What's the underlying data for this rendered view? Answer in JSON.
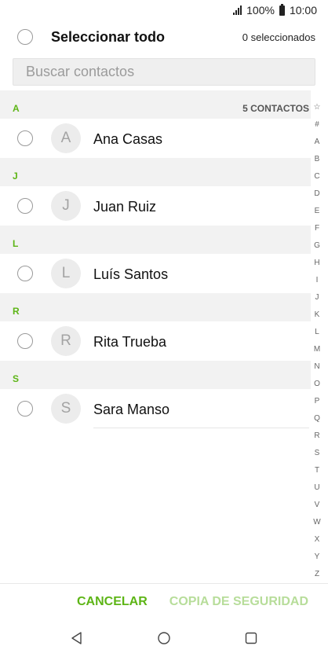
{
  "status_bar": {
    "battery_pct": "100%",
    "time": "10:00"
  },
  "header": {
    "select_all": "Seleccionar todo",
    "selected_count": "0 seleccionados"
  },
  "search": {
    "placeholder": "Buscar contactos"
  },
  "contacts_total": "5 CONTACTOS",
  "sections": [
    {
      "letter": "A",
      "contacts": [
        {
          "initial": "A",
          "name": "Ana Casas"
        }
      ]
    },
    {
      "letter": "J",
      "contacts": [
        {
          "initial": "J",
          "name": "Juan Ruiz"
        }
      ]
    },
    {
      "letter": "L",
      "contacts": [
        {
          "initial": "L",
          "name": "Luís Santos"
        }
      ]
    },
    {
      "letter": "R",
      "contacts": [
        {
          "initial": "R",
          "name": "Rita Trueba"
        }
      ]
    },
    {
      "letter": "S",
      "contacts": [
        {
          "initial": "S",
          "name": "Sara Manso"
        }
      ]
    }
  ],
  "index_letters": [
    "☆",
    "#",
    "A",
    "B",
    "C",
    "D",
    "E",
    "F",
    "G",
    "H",
    "I",
    "J",
    "K",
    "L",
    "M",
    "N",
    "O",
    "P",
    "Q",
    "R",
    "S",
    "T",
    "U",
    "V",
    "W",
    "X",
    "Y",
    "Z"
  ],
  "footer": {
    "cancel": "CANCELAR",
    "backup": "COPIA DE SEGURIDAD"
  },
  "navigation": {
    "back_icon": "back-triangle-icon",
    "home_icon": "home-circle-icon",
    "recent_icon": "recent-square-icon"
  },
  "colors": {
    "accent": "#5db516",
    "accent_disabled": "#b7dd9a"
  }
}
